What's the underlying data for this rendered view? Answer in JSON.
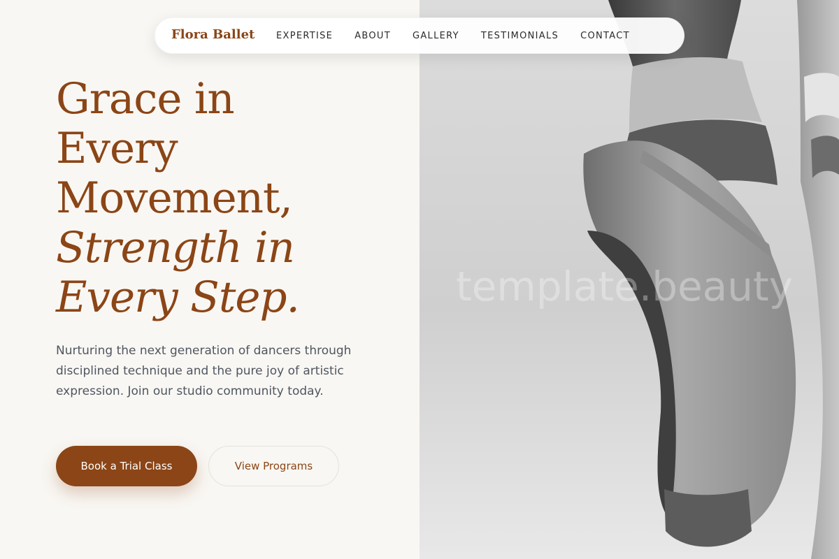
{
  "nav": {
    "brand": "Flora Ballet",
    "links": [
      "EXPERTISE",
      "ABOUT",
      "GALLERY",
      "TESTIMONIALS",
      "CONTACT"
    ]
  },
  "hero": {
    "headline_lines": [
      "Grace in",
      "Every",
      "Movement,"
    ],
    "headline_italic_lines": [
      "Strength in",
      "Every Step."
    ],
    "subtext": "Nurturing the next generation of dancers through disciplined technique and the pure joy of artistic expression. Join our studio community today.",
    "primary_button": "Book a Trial Class",
    "secondary_button": "View Programs"
  },
  "image": {
    "watermark": "template.beauty",
    "icon": "ballet-pointe-shoes-photo"
  },
  "colors": {
    "brand": "#8b4516",
    "background": "#f9f7f3",
    "body_text": "#4f5661"
  }
}
